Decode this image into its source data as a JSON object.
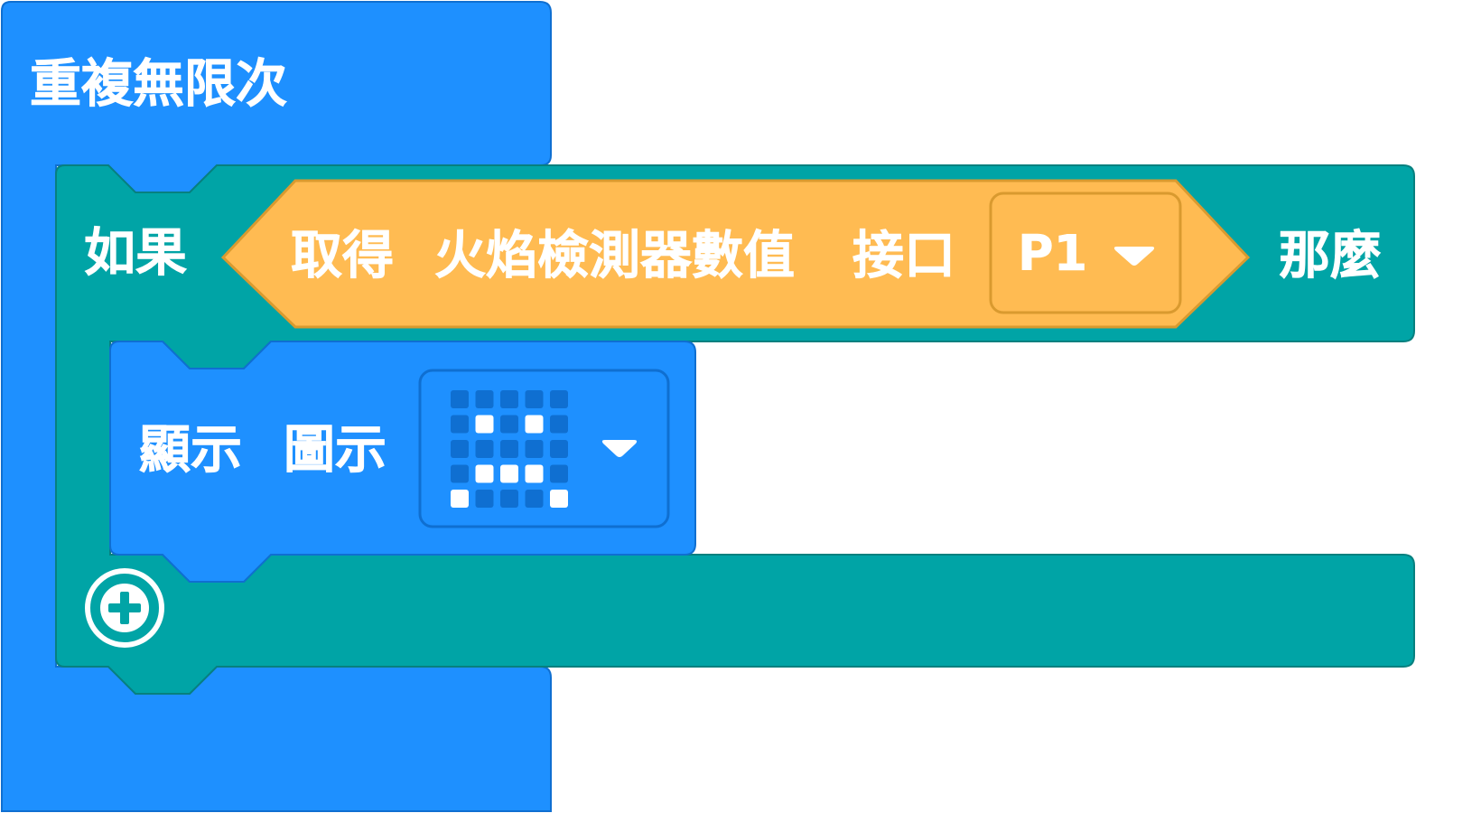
{
  "colors": {
    "loop_block": "#1e90ff",
    "loop_border": "#0f6fd1",
    "if_block": "#00a4a6",
    "if_border": "#07807f",
    "sensor_block": "#ffbb52",
    "sensor_border": "#d99a2f",
    "led_on": "#ffffff",
    "led_off": "#0f6fd1"
  },
  "loop_block": {
    "label": "重複無限次"
  },
  "if_block": {
    "if_label": "如果",
    "then_label": "那麼"
  },
  "sensor_block": {
    "get_label": "取得",
    "sensor_label": "火焰檢測器數值",
    "port_label": "接口",
    "port_value": "P1"
  },
  "show_icon_block": {
    "show_label": "顯示",
    "icon_label": "圖示",
    "led_grid": [
      [
        0,
        0,
        0,
        0,
        0
      ],
      [
        0,
        1,
        0,
        1,
        0
      ],
      [
        0,
        0,
        0,
        0,
        0
      ],
      [
        0,
        1,
        1,
        1,
        0
      ],
      [
        1,
        0,
        0,
        0,
        1
      ]
    ]
  },
  "icons": {
    "add_else": "plus-circle-icon",
    "dropdown": "triangle-down-icon"
  }
}
